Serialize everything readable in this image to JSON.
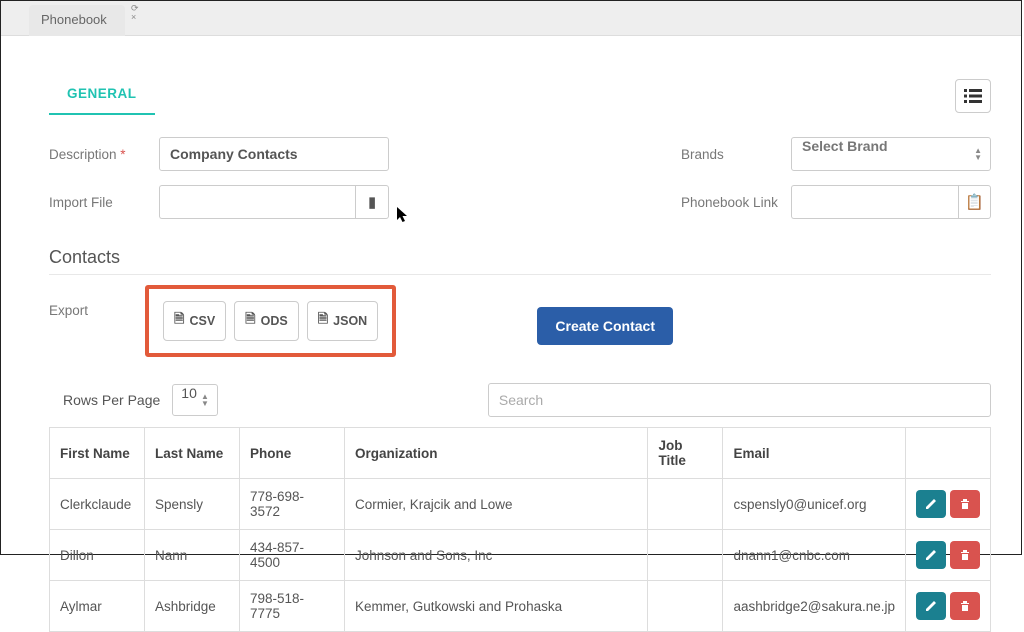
{
  "tab": {
    "title": "Phonebook"
  },
  "tabs": {
    "general": "GENERAL"
  },
  "form": {
    "description_label": "Description",
    "description_value": "Company Contacts",
    "import_file_label": "Import File",
    "brands_label": "Brands",
    "brands_placeholder": "Select Brand",
    "phonebook_link_label": "Phonebook Link"
  },
  "contacts": {
    "section_title": "Contacts",
    "export_label": "Export",
    "export_buttons": {
      "csv": "CSV",
      "ods": "ODS",
      "json": "JSON"
    },
    "create_button": "Create Contact",
    "rows_per_page_label": "Rows Per Page",
    "rows_per_page_value": "10",
    "search_placeholder": "Search",
    "columns": {
      "first_name": "First Name",
      "last_name": "Last Name",
      "phone": "Phone",
      "organization": "Organization",
      "job_title": "Job Title",
      "email": "Email"
    },
    "rows": [
      {
        "first_name": "Clerkclaude",
        "last_name": "Spensly",
        "phone": "778-698-3572",
        "organization": "Cormier, Krajcik and Lowe",
        "job_title": "",
        "email": "cspensly0@unicef.org"
      },
      {
        "first_name": "Dillon",
        "last_name": "Nann",
        "phone": "434-857-4500",
        "organization": "Johnson and Sons, Inc",
        "job_title": "",
        "email": "dnann1@cnbc.com"
      },
      {
        "first_name": "Aylmar",
        "last_name": "Ashbridge",
        "phone": "798-518-7775",
        "organization": "Kemmer, Gutkowski and Prohaska",
        "job_title": "",
        "email": "aashbridge2@sakura.ne.jp"
      }
    ]
  }
}
